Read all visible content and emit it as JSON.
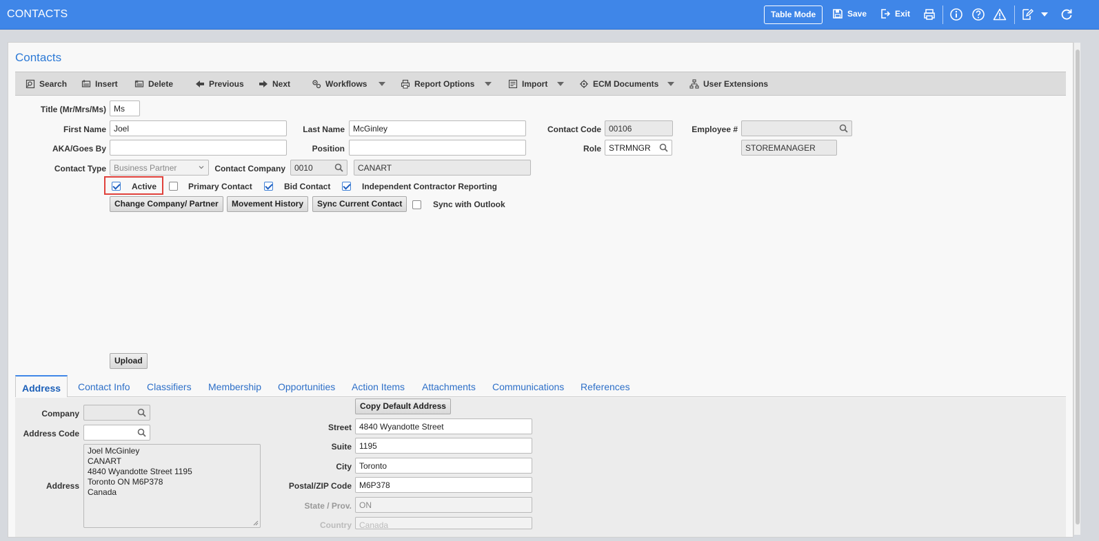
{
  "header": {
    "title": "CONTACTS",
    "table_mode": "Table Mode",
    "save": "Save",
    "exit": "Exit"
  },
  "panel": {
    "title": "Contacts"
  },
  "toolbar": {
    "search": "Search",
    "insert": "Insert",
    "delete": "Delete",
    "previous": "Previous",
    "next": "Next",
    "workflows": "Workflows",
    "report_options": "Report Options",
    "import": "Import",
    "ecm_documents": "ECM Documents",
    "user_extensions": "User Extensions"
  },
  "form": {
    "title_label": "Title (Mr/Mrs/Ms)",
    "title_value": "Ms",
    "first_name_label": "First Name",
    "first_name_value": "Joel",
    "last_name_label": "Last Name",
    "last_name_value": "McGinley",
    "contact_code_label": "Contact Code",
    "contact_code_value": "00106",
    "employee_label": "Employee #",
    "employee_value": "",
    "aka_label": "AKA/Goes By",
    "aka_value": "",
    "position_label": "Position",
    "position_value": "",
    "role_label": "Role",
    "role_value": "STRMNGR",
    "role_desc": "STOREMANAGER",
    "contact_type_label": "Contact Type",
    "contact_type_value": "Business Partner",
    "contact_company_label": "Contact Company",
    "contact_company_code": "0010",
    "contact_company_name": "CANART",
    "active_label": "Active",
    "active_checked": true,
    "primary_label": "Primary Contact",
    "primary_checked": false,
    "bid_label": "Bid Contact",
    "bid_checked": true,
    "icr_label": "Independent Contractor Reporting",
    "icr_checked": true,
    "change_company_button": "Change Company/ Partner",
    "movement_history_button": "Movement History",
    "sync_current_button": "Sync Current Contact",
    "sync_outlook_label": "Sync with Outlook",
    "sync_outlook_checked": false,
    "upload_button": "Upload"
  },
  "tabs": [
    {
      "label": "Address",
      "active": true
    },
    {
      "label": "Contact Info"
    },
    {
      "label": "Classifiers"
    },
    {
      "label": "Membership"
    },
    {
      "label": "Opportunities"
    },
    {
      "label": "Action Items"
    },
    {
      "label": "Attachments"
    },
    {
      "label": "Communications"
    },
    {
      "label": "References"
    }
  ],
  "address": {
    "company_label": "Company",
    "company_value": "",
    "address_code_label": "Address Code",
    "address_code_value": "",
    "address_label": "Address",
    "address_lines": [
      "Joel McGinley",
      "CANART",
      "4840 Wyandotte Street 1195",
      "Toronto ON M6P378",
      "Canada"
    ],
    "copy_default_button": "Copy Default Address",
    "street_label": "Street",
    "street_value": "4840 Wyandotte Street",
    "suite_label": "Suite",
    "suite_value": "1195",
    "city_label": "City",
    "city_value": "Toronto",
    "postal_label": "Postal/ZIP Code",
    "postal_value": "M6P378",
    "state_label": "State / Prov.",
    "state_value": "ON",
    "country_label": "Country",
    "country_value": "Canada"
  },
  "colors": {
    "accent": "#3f86e8",
    "highlight": "#e0403a"
  }
}
